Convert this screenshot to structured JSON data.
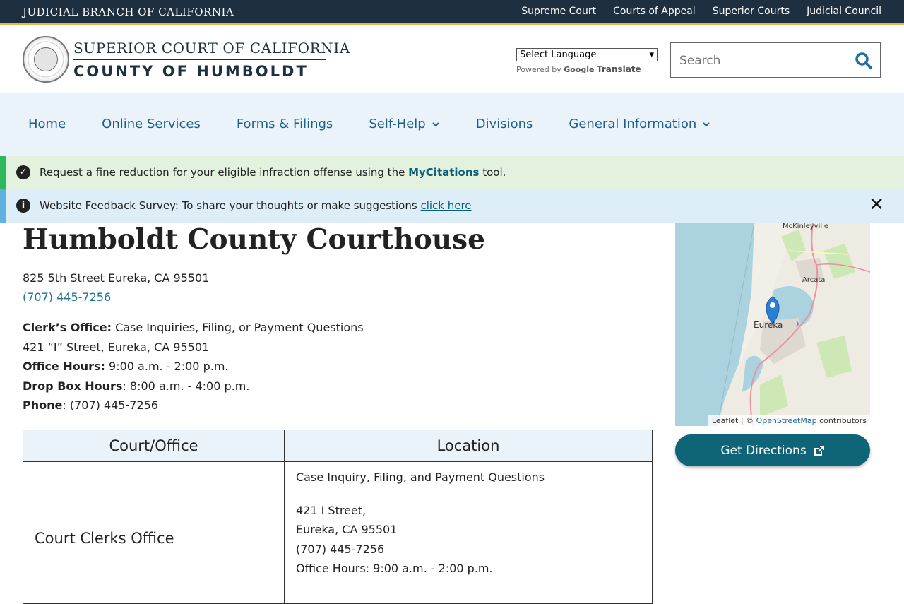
{
  "topbar": {
    "branch": "JUDICIAL BRANCH OF CALIFORNIA",
    "links": [
      "Supreme Court",
      "Courts of Appeal",
      "Superior Courts",
      "Judicial Council"
    ]
  },
  "header": {
    "line1": "SUPERIOR COURT OF CALIFORNIA",
    "line2": "COUNTY OF HUMBOLDT",
    "language_select": "Select Language",
    "powered_by": "Powered by",
    "google": "Google",
    "translate": "Translate",
    "search_placeholder": "Search"
  },
  "nav": {
    "items": [
      {
        "label": "Home",
        "dropdown": false
      },
      {
        "label": "Online Services",
        "dropdown": false
      },
      {
        "label": "Forms & Filings",
        "dropdown": false
      },
      {
        "label": "Self-Help",
        "dropdown": true
      },
      {
        "label": "Divisions",
        "dropdown": false
      },
      {
        "label": "General Information",
        "dropdown": true
      }
    ]
  },
  "alerts": {
    "green": {
      "before": "Request a fine reduction for your eligible infraction offense using the",
      "link": "MyCitations",
      "after": "tool."
    },
    "blue": {
      "before": "Website Feedback Survey: To share your thoughts or make suggestions",
      "link": "click here"
    }
  },
  "main": {
    "title": "Humboldt County Courthouse",
    "address": "825 5th Street Eureka, CA 95501",
    "phone": "(707) 445-7256",
    "clerk_label": "Clerk’s Office:",
    "clerk_desc": "Case Inquiries, Filing, or Payment Questions",
    "clerk_address": "421 “I” Street, Eureka, CA 95501",
    "office_hours_label": "Office Hours:",
    "office_hours": "9:00 a.m. - 2:00 p.m.",
    "dropbox_label": "Drop Box Hours",
    "dropbox_hours": ": 8:00 a.m. - 4:00 p.m.",
    "phone_label": "Phone",
    "phone_value": ": (707) 445-7256"
  },
  "table": {
    "headers": [
      "Court/Office",
      "Location"
    ],
    "rows": [
      {
        "office": "Court Clerks Office",
        "lines": [
          "Case Inquiry, Filing, and Payment Questions",
          "421 I Street,",
          "Eureka, CA 95501",
          "(707) 445-7256",
          "Office Hours: 9:00 a.m. - 2:00 p.m."
        ]
      }
    ]
  },
  "map": {
    "places": [
      "McKinleyville",
      "Arcata",
      "Eureka"
    ],
    "attribution_leaflet": "Leaflet",
    "attribution_sep": "| ©",
    "attribution_osm": "OpenStreetMap",
    "attribution_contrib": "contributors"
  },
  "directions_label": "Get Directions"
}
